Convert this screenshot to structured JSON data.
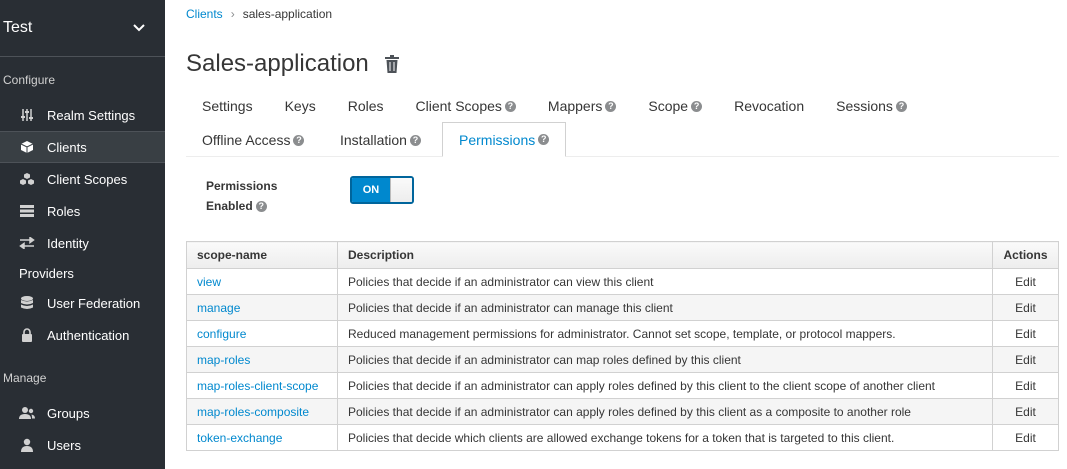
{
  "sidebar": {
    "realm": "Test",
    "configure_label": "Configure",
    "configure_items": [
      {
        "label": "Realm Settings",
        "icon": "sliders-icon"
      },
      {
        "label": "Clients",
        "icon": "cube-icon",
        "active": true
      },
      {
        "label": "Client Scopes",
        "icon": "cubes-icon"
      },
      {
        "label": "Roles",
        "icon": "list-icon"
      },
      {
        "label": "Identity",
        "label2": "Providers",
        "icon": "exchange-icon"
      },
      {
        "label": "User Federation",
        "icon": "database-icon"
      },
      {
        "label": "Authentication",
        "icon": "lock-icon"
      }
    ],
    "manage_label": "Manage",
    "manage_items": [
      {
        "label": "Groups",
        "icon": "users-icon"
      },
      {
        "label": "Users",
        "icon": "user-icon"
      }
    ]
  },
  "breadcrumb": {
    "parent": "Clients",
    "current": "sales-application"
  },
  "page": {
    "title": "Sales-application"
  },
  "tabs_row1": [
    "Settings",
    "Keys",
    "Roles",
    "Client Scopes",
    "Mappers",
    "Scope",
    "Revocation",
    "Sessions"
  ],
  "tabs_row2": [
    "Offline Access",
    "Installation",
    "Permissions"
  ],
  "permissions": {
    "label_line1": "Permissions",
    "label_line2": "Enabled",
    "toggle": "ON"
  },
  "table": {
    "headers": [
      "scope-name",
      "Description",
      "Actions"
    ],
    "rows": [
      {
        "name": "view",
        "desc": "Policies that decide if an administrator can view this client",
        "action": "Edit"
      },
      {
        "name": "manage",
        "desc": "Policies that decide if an administrator can manage this client",
        "action": "Edit"
      },
      {
        "name": "configure",
        "desc": "Reduced management permissions for administrator. Cannot set scope, template, or protocol mappers.",
        "action": "Edit"
      },
      {
        "name": "map-roles",
        "desc": "Policies that decide if an administrator can map roles defined by this client",
        "action": "Edit"
      },
      {
        "name": "map-roles-client-scope",
        "desc": "Policies that decide if an administrator can apply roles defined by this client to the client scope of another client",
        "action": "Edit"
      },
      {
        "name": "map-roles-composite",
        "desc": "Policies that decide if an administrator can apply roles defined by this client as a composite to another role",
        "action": "Edit"
      },
      {
        "name": "token-exchange",
        "desc": "Policies that decide which clients are allowed exchange tokens for a token that is targeted to this client.",
        "action": "Edit"
      }
    ]
  }
}
